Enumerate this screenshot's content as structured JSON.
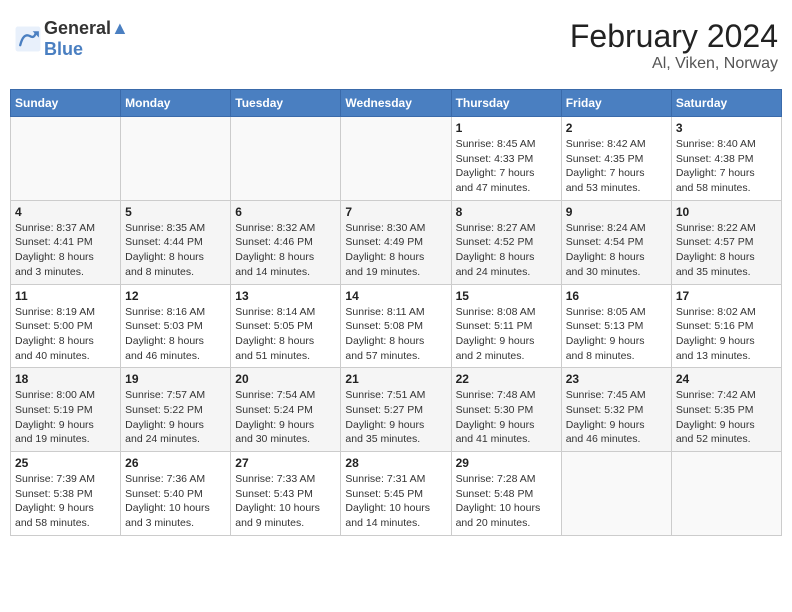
{
  "header": {
    "logo_line1": "General",
    "logo_line2": "Blue",
    "month_title": "February 2024",
    "location": "Al, Viken, Norway"
  },
  "weekdays": [
    "Sunday",
    "Monday",
    "Tuesday",
    "Wednesday",
    "Thursday",
    "Friday",
    "Saturday"
  ],
  "weeks": [
    [
      {
        "day": "",
        "info": ""
      },
      {
        "day": "",
        "info": ""
      },
      {
        "day": "",
        "info": ""
      },
      {
        "day": "",
        "info": ""
      },
      {
        "day": "1",
        "info": "Sunrise: 8:45 AM\nSunset: 4:33 PM\nDaylight: 7 hours\nand 47 minutes."
      },
      {
        "day": "2",
        "info": "Sunrise: 8:42 AM\nSunset: 4:35 PM\nDaylight: 7 hours\nand 53 minutes."
      },
      {
        "day": "3",
        "info": "Sunrise: 8:40 AM\nSunset: 4:38 PM\nDaylight: 7 hours\nand 58 minutes."
      }
    ],
    [
      {
        "day": "4",
        "info": "Sunrise: 8:37 AM\nSunset: 4:41 PM\nDaylight: 8 hours\nand 3 minutes."
      },
      {
        "day": "5",
        "info": "Sunrise: 8:35 AM\nSunset: 4:44 PM\nDaylight: 8 hours\nand 8 minutes."
      },
      {
        "day": "6",
        "info": "Sunrise: 8:32 AM\nSunset: 4:46 PM\nDaylight: 8 hours\nand 14 minutes."
      },
      {
        "day": "7",
        "info": "Sunrise: 8:30 AM\nSunset: 4:49 PM\nDaylight: 8 hours\nand 19 minutes."
      },
      {
        "day": "8",
        "info": "Sunrise: 8:27 AM\nSunset: 4:52 PM\nDaylight: 8 hours\nand 24 minutes."
      },
      {
        "day": "9",
        "info": "Sunrise: 8:24 AM\nSunset: 4:54 PM\nDaylight: 8 hours\nand 30 minutes."
      },
      {
        "day": "10",
        "info": "Sunrise: 8:22 AM\nSunset: 4:57 PM\nDaylight: 8 hours\nand 35 minutes."
      }
    ],
    [
      {
        "day": "11",
        "info": "Sunrise: 8:19 AM\nSunset: 5:00 PM\nDaylight: 8 hours\nand 40 minutes."
      },
      {
        "day": "12",
        "info": "Sunrise: 8:16 AM\nSunset: 5:03 PM\nDaylight: 8 hours\nand 46 minutes."
      },
      {
        "day": "13",
        "info": "Sunrise: 8:14 AM\nSunset: 5:05 PM\nDaylight: 8 hours\nand 51 minutes."
      },
      {
        "day": "14",
        "info": "Sunrise: 8:11 AM\nSunset: 5:08 PM\nDaylight: 8 hours\nand 57 minutes."
      },
      {
        "day": "15",
        "info": "Sunrise: 8:08 AM\nSunset: 5:11 PM\nDaylight: 9 hours\nand 2 minutes."
      },
      {
        "day": "16",
        "info": "Sunrise: 8:05 AM\nSunset: 5:13 PM\nDaylight: 9 hours\nand 8 minutes."
      },
      {
        "day": "17",
        "info": "Sunrise: 8:02 AM\nSunset: 5:16 PM\nDaylight: 9 hours\nand 13 minutes."
      }
    ],
    [
      {
        "day": "18",
        "info": "Sunrise: 8:00 AM\nSunset: 5:19 PM\nDaylight: 9 hours\nand 19 minutes."
      },
      {
        "day": "19",
        "info": "Sunrise: 7:57 AM\nSunset: 5:22 PM\nDaylight: 9 hours\nand 24 minutes."
      },
      {
        "day": "20",
        "info": "Sunrise: 7:54 AM\nSunset: 5:24 PM\nDaylight: 9 hours\nand 30 minutes."
      },
      {
        "day": "21",
        "info": "Sunrise: 7:51 AM\nSunset: 5:27 PM\nDaylight: 9 hours\nand 35 minutes."
      },
      {
        "day": "22",
        "info": "Sunrise: 7:48 AM\nSunset: 5:30 PM\nDaylight: 9 hours\nand 41 minutes."
      },
      {
        "day": "23",
        "info": "Sunrise: 7:45 AM\nSunset: 5:32 PM\nDaylight: 9 hours\nand 46 minutes."
      },
      {
        "day": "24",
        "info": "Sunrise: 7:42 AM\nSunset: 5:35 PM\nDaylight: 9 hours\nand 52 minutes."
      }
    ],
    [
      {
        "day": "25",
        "info": "Sunrise: 7:39 AM\nSunset: 5:38 PM\nDaylight: 9 hours\nand 58 minutes."
      },
      {
        "day": "26",
        "info": "Sunrise: 7:36 AM\nSunset: 5:40 PM\nDaylight: 10 hours\nand 3 minutes."
      },
      {
        "day": "27",
        "info": "Sunrise: 7:33 AM\nSunset: 5:43 PM\nDaylight: 10 hours\nand 9 minutes."
      },
      {
        "day": "28",
        "info": "Sunrise: 7:31 AM\nSunset: 5:45 PM\nDaylight: 10 hours\nand 14 minutes."
      },
      {
        "day": "29",
        "info": "Sunrise: 7:28 AM\nSunset: 5:48 PM\nDaylight: 10 hours\nand 20 minutes."
      },
      {
        "day": "",
        "info": ""
      },
      {
        "day": "",
        "info": ""
      }
    ]
  ]
}
